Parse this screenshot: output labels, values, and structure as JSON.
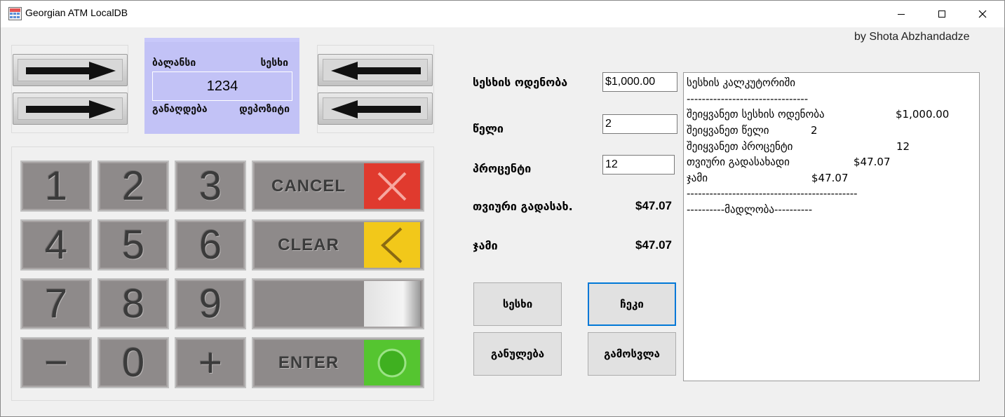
{
  "window": {
    "title": "Georgian ATM LocalDB"
  },
  "byline": "by Shota Abzhandadze",
  "screen": {
    "balance_label": "ბალანსი",
    "loan_label": "სესხი",
    "pin_value": "1234",
    "withdraw_label": "განაღდება",
    "deposit_label": "დეპოზიტი"
  },
  "keypad": {
    "keys": [
      "1",
      "2",
      "3",
      "4",
      "5",
      "6",
      "7",
      "8",
      "9",
      "−",
      "0",
      "+"
    ],
    "cancel_label": "CANCEL",
    "clear_label": "CLEAR",
    "enter_label": "ENTER"
  },
  "colors": {
    "cancel": "#e03a2e",
    "clear": "#f2c81a",
    "enter": "#55c530",
    "screen": "#c2c2f6"
  },
  "form": {
    "amount_label": "სესხის ოდენობა",
    "amount_value": "$1,000.00",
    "years_label": "წელი",
    "years_value": "2",
    "percent_label": "პროცენტი",
    "percent_value": "12",
    "monthly_label": "თვიური გადასახ.",
    "monthly_value": "$47.07",
    "total_label": "ჯამი",
    "total_value": "$47.07"
  },
  "buttons": {
    "loan": "სესხი",
    "receipt": "ჩეკი",
    "reset": "განულება",
    "exit": "გამოსვლა"
  },
  "receipt": {
    "title": "სესხის კალკუტორიში",
    "separator_short": "--------------------------------",
    "amount_label": "შეიყვანეთ სესხის ოდენობა",
    "amount_value": "$1,000.00",
    "years_label": "შეიყვანეთ წელი",
    "years_value": "2",
    "percent_label": "შეიყვანეთ პროცენტი",
    "percent_value": "12",
    "monthly_label": "თვიური გადასახადი",
    "monthly_value": "$47.07",
    "total_label": "ჯამი",
    "total_value": "$47.07",
    "separator_long": "---------------------------------------------",
    "thanks": "----------მადლობა----------"
  }
}
